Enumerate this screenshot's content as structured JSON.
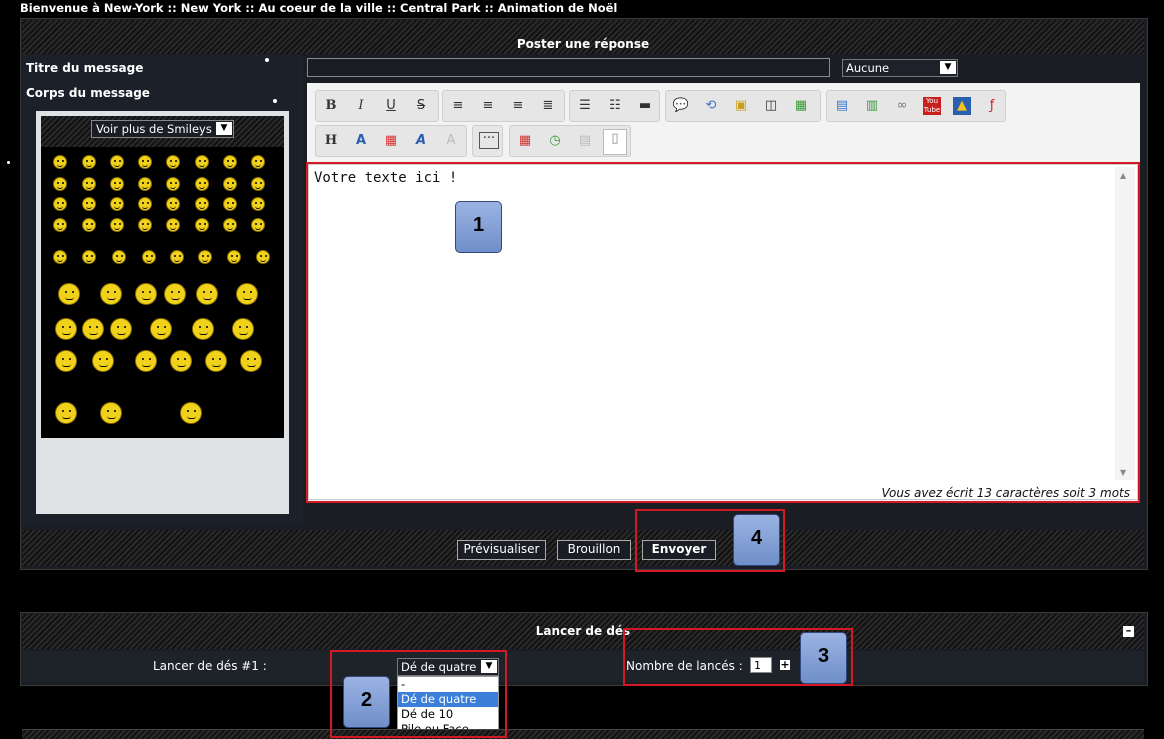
{
  "breadcrumb": "Bienvenue à New-York  :: New York :: Au coeur de la ville :: Central Park :: Animation de Noël",
  "post": {
    "header": "Poster une réponse",
    "title_label": "Titre du message",
    "body_label": "Corps du message",
    "title_value": "",
    "title_select": "Aucune",
    "smileys_select": "Voir plus de Smileys",
    "editor_text": "Votre texte ici !",
    "counter": "Vous avez écrit 13 caractères soit 3 mots",
    "toolbar_row1": [
      "bold-icon",
      "italic-icon",
      "underline-icon",
      "strike-icon",
      "align-left-icon",
      "align-center-icon",
      "align-right-icon",
      "justify-icon",
      "bullet-list-icon",
      "numbered-list-icon",
      "hr-icon",
      "quote-icon",
      "code-icon",
      "spoiler-icon",
      "hide-icon",
      "table-icon",
      "image-icon",
      "host-image-icon",
      "link-icon",
      "youtube-icon",
      "dailymotion-icon",
      "flash-icon"
    ],
    "toolbar_row2": [
      "heading-icon",
      "font-size-icon",
      "color-icon",
      "font-icon",
      "clear-format-icon",
      "more-icon",
      "date-icon",
      "time-icon",
      "paste-icon",
      "source-icon"
    ],
    "buttons": {
      "preview": "Prévisualiser",
      "draft": "Brouillon",
      "send": "Envoyer"
    }
  },
  "dice": {
    "header": "Lancer de dés",
    "row_label": "Lancer de dés #1 :",
    "select_value": "Dé de quatre",
    "options": [
      "-",
      "Dé de quatre",
      "Dé de 10",
      "Pile ou Face"
    ],
    "count_label": "Nombre de lancés :",
    "count_value": "1"
  },
  "annotations": [
    "1",
    "2",
    "3",
    "4"
  ],
  "colors": {
    "highlight": "#d31a24",
    "badge": "#8ea6dd",
    "selected_option": "#3b7fd8"
  }
}
